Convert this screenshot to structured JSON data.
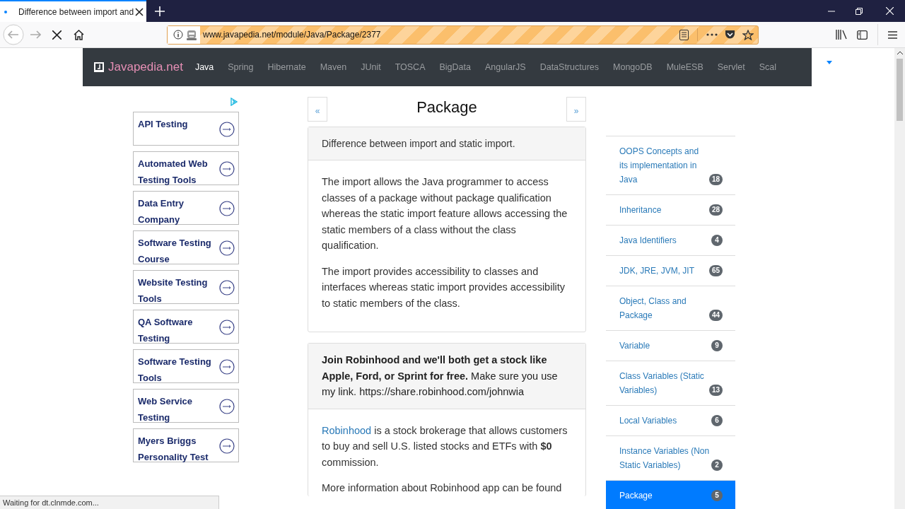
{
  "browser": {
    "tab": {
      "title": "Difference between import and",
      "loading": true
    },
    "url": "www.javapedia.net/module/Java/Package/2377",
    "status": "Waiting for dt.clnmde.com..."
  },
  "navbar": {
    "brand": "Javapedia.net",
    "items": [
      {
        "label": "Java",
        "selected": true
      },
      {
        "label": "Spring",
        "selected": false
      },
      {
        "label": "Hibernate",
        "selected": false
      },
      {
        "label": "Maven",
        "selected": false
      },
      {
        "label": "JUnit",
        "selected": false
      },
      {
        "label": "TOSCA",
        "selected": false
      },
      {
        "label": "BigData",
        "selected": false
      },
      {
        "label": "AngularJS",
        "selected": false
      },
      {
        "label": "DataStructures",
        "selected": false
      },
      {
        "label": "MongoDB",
        "selected": false
      },
      {
        "label": "MuleESB",
        "selected": false
      },
      {
        "label": "Servlet",
        "selected": false
      },
      {
        "label": "Scal",
        "selected": false
      }
    ]
  },
  "ads": [
    "API Testing",
    "Automated Web Testing Tools",
    "Data Entry Company",
    "Software Testing Course",
    "Website Testing Tools",
    "QA Software Testing",
    "Software Testing Tools",
    "Web Service Testing",
    "Myers Briggs Personality Test"
  ],
  "article": {
    "prev": "«",
    "next": "»",
    "title": "Package",
    "question": "Difference between import and static import.",
    "answer": [
      "The import allows the Java programmer to access classes of a package without package qualification whereas the static import feature allows accessing the static members of a class without the class qualification.",
      "The import provides accessibility to classes and interfaces whereas static import provides accessibility to static members of the class."
    ]
  },
  "promo": {
    "header": "**Join Robinhood and we'll both get a stock like Apple, Ford, or Sprint for free.** Make sure you use my link. https://share.robinhood.com/johnwia",
    "link": "Robinhood",
    "body": " is a stock brokerage that allows customers to buy and sell U.S. listed stocks and ETFs with **$0** commission.",
    "more": "More information about Robinhood app can be found"
  },
  "topics": [
    {
      "label": "OOPS Concepts and its implementation in Java",
      "count": "18",
      "selected": false
    },
    {
      "label": "Inheritance",
      "count": "28",
      "selected": false
    },
    {
      "label": "Java Identifiers",
      "count": "4",
      "selected": false
    },
    {
      "label": "JDK, JRE, JVM, JIT",
      "count": "65",
      "selected": false
    },
    {
      "label": "Object, Class and Package",
      "count": "44",
      "selected": false
    },
    {
      "label": "Variable",
      "count": "9",
      "selected": false
    },
    {
      "label": "Class Variables (Static Variables)",
      "count": "13",
      "selected": false
    },
    {
      "label": "Local Variables",
      "count": "6",
      "selected": false
    },
    {
      "label": "Instance Variables (Non Static Variables)",
      "count": "2",
      "selected": false
    },
    {
      "label": "Package",
      "count": "5",
      "selected": true
    }
  ]
}
